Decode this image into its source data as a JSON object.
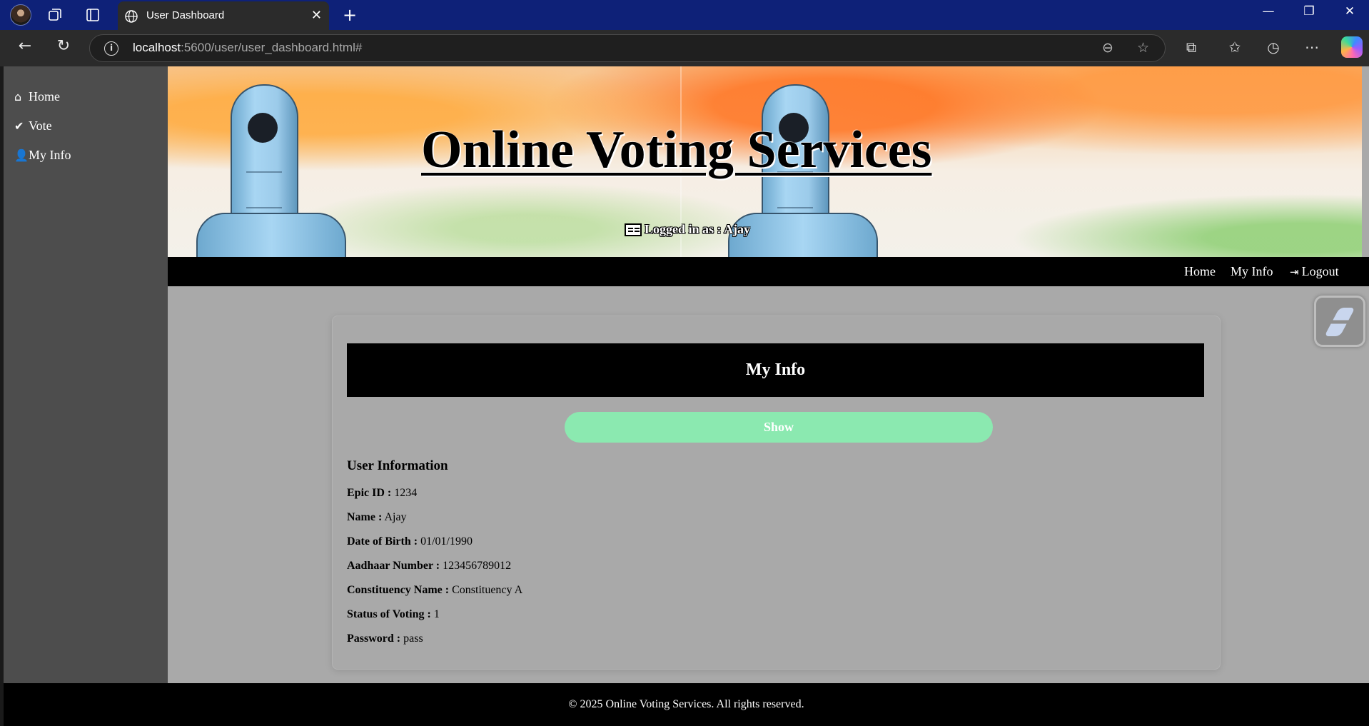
{
  "browser": {
    "tab_title": "User Dashboard",
    "url_host": "localhost",
    "url_rest": ":5600/user/user_dashboard.html#",
    "icons": [
      "profile-avatar",
      "workspaces-icon",
      "tab-actions-icon",
      "globe-icon",
      "close-icon",
      "new-tab-icon",
      "minimize-icon",
      "restore-icon",
      "window-close-icon",
      "back-icon",
      "refresh-icon",
      "info-icon",
      "zoom-out-icon",
      "star-icon",
      "extensions-icon",
      "favorites-icon",
      "history-icon",
      "more-icon",
      "copilot-icon"
    ]
  },
  "sidebar": {
    "items": [
      {
        "label": "Home",
        "icon": "home-icon"
      },
      {
        "label": "Vote",
        "icon": "check-circle-icon"
      },
      {
        "label": "My Info",
        "icon": "user-icon"
      }
    ]
  },
  "banner": {
    "title": "Online Voting Services",
    "logged_in_text": "Logged in as : Ajay"
  },
  "topnav": {
    "home": "Home",
    "my_info": "My Info",
    "logout": "Logout"
  },
  "card": {
    "header": "My Info",
    "show_button": "Show",
    "info_title": "User Information",
    "rows": [
      {
        "label": "Epic ID :",
        "value": "1234"
      },
      {
        "label": "Name :",
        "value": "Ajay"
      },
      {
        "label": "Date of Birth :",
        "value": "01/01/1990"
      },
      {
        "label": "Aadhaar Number :",
        "value": "123456789012"
      },
      {
        "label": "Constituency Name :",
        "value": "Constituency A"
      },
      {
        "label": "Status of Voting :",
        "value": "1"
      },
      {
        "label": "Password :",
        "value": "pass"
      }
    ]
  },
  "footer": {
    "text": "© 2025 Online Voting Services. All rights reserved."
  },
  "colors": {
    "titlebar": "#0e2178",
    "sidebar": "#4d4d4d",
    "content_bg": "#a9a9a9",
    "show_button": "#8be9b0",
    "nav_bg": "#000000"
  }
}
